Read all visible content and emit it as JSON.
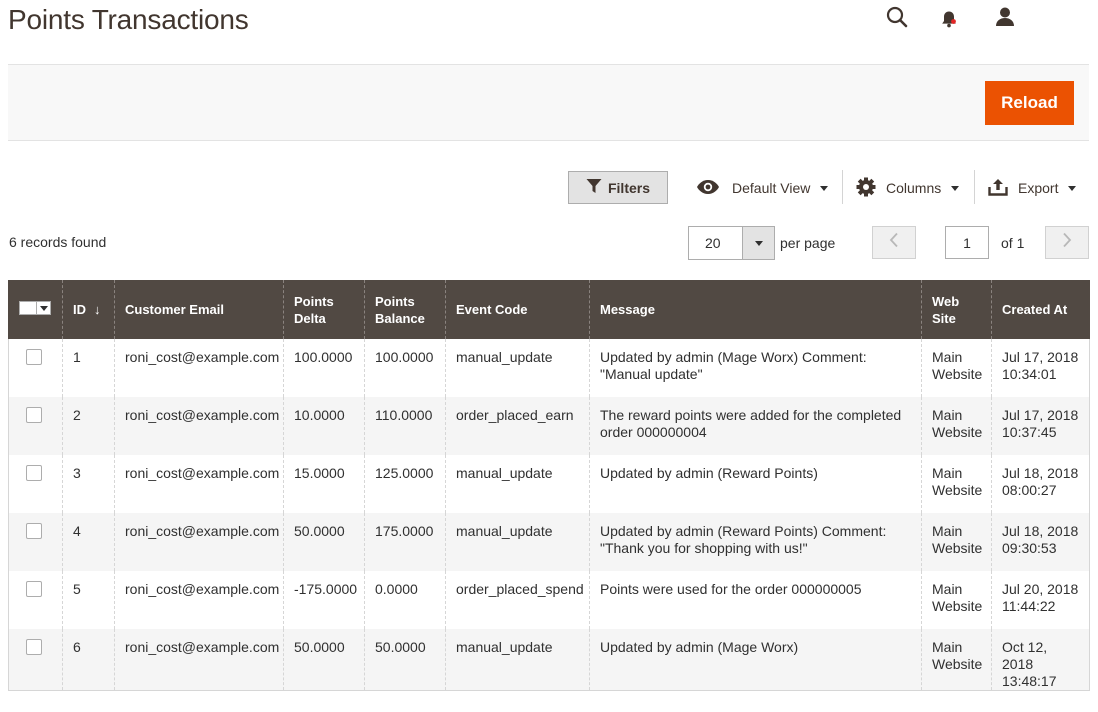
{
  "header": {
    "title": "Points Transactions",
    "icons": [
      "search-icon",
      "notifications-icon",
      "account-icon"
    ]
  },
  "action_bar": {
    "reload_label": "Reload"
  },
  "toolbar": {
    "filters_label": "Filters",
    "default_view_label": "Default View",
    "columns_label": "Columns",
    "export_label": "Export"
  },
  "records_found": "6 records found",
  "pager": {
    "per_page_value": "20",
    "per_page_label": "per page",
    "current_page": "1",
    "of_label": "of 1"
  },
  "colors": {
    "accent": "#eb5202",
    "header_bg": "#514943",
    "title": "#41362f"
  },
  "table": {
    "columns": {
      "id": "ID",
      "email": "Customer Email",
      "delta": "Points Delta",
      "balance": "Points Balance",
      "event": "Event Code",
      "message": "Message",
      "website": "Web Site",
      "created": "Created At"
    },
    "sort_indicator": "↓",
    "rows": [
      {
        "id": "1",
        "email": "roni_cost@example.com",
        "delta": "100.0000",
        "balance": "100.0000",
        "event": "manual_update",
        "message": "Updated by admin (Mage Worx) Comment: \"Manual update\"",
        "website": "Main Website",
        "created": "Jul 17, 2018 10:34:01"
      },
      {
        "id": "2",
        "email": "roni_cost@example.com",
        "delta": "10.0000",
        "balance": "110.0000",
        "event": "order_placed_earn",
        "message": "The reward points were added for the completed order 000000004",
        "website": "Main Website",
        "created": "Jul 17, 2018 10:37:45"
      },
      {
        "id": "3",
        "email": "roni_cost@example.com",
        "delta": "15.0000",
        "balance": "125.0000",
        "event": "manual_update",
        "message": "Updated by admin (Reward Points)",
        "website": "Main Website",
        "created": "Jul 18, 2018 08:00:27"
      },
      {
        "id": "4",
        "email": "roni_cost@example.com",
        "delta": "50.0000",
        "balance": "175.0000",
        "event": "manual_update",
        "message": "Updated by admin (Reward Points) Comment: \"Thank you for shopping with us!\"",
        "website": "Main Website",
        "created": "Jul 18, 2018 09:30:53"
      },
      {
        "id": "5",
        "email": "roni_cost@example.com",
        "delta": "-175.0000",
        "balance": "0.0000",
        "event": "order_placed_spend",
        "message": "Points were used for the order 000000005",
        "website": "Main Website",
        "created": "Jul 20, 2018 11:44:22"
      },
      {
        "id": "6",
        "email": "roni_cost@example.com",
        "delta": "50.0000",
        "balance": "50.0000",
        "event": "manual_update",
        "message": "Updated by admin (Mage Worx)",
        "website": "Main Website",
        "created": "Oct 12, 2018 13:48:17"
      }
    ]
  }
}
